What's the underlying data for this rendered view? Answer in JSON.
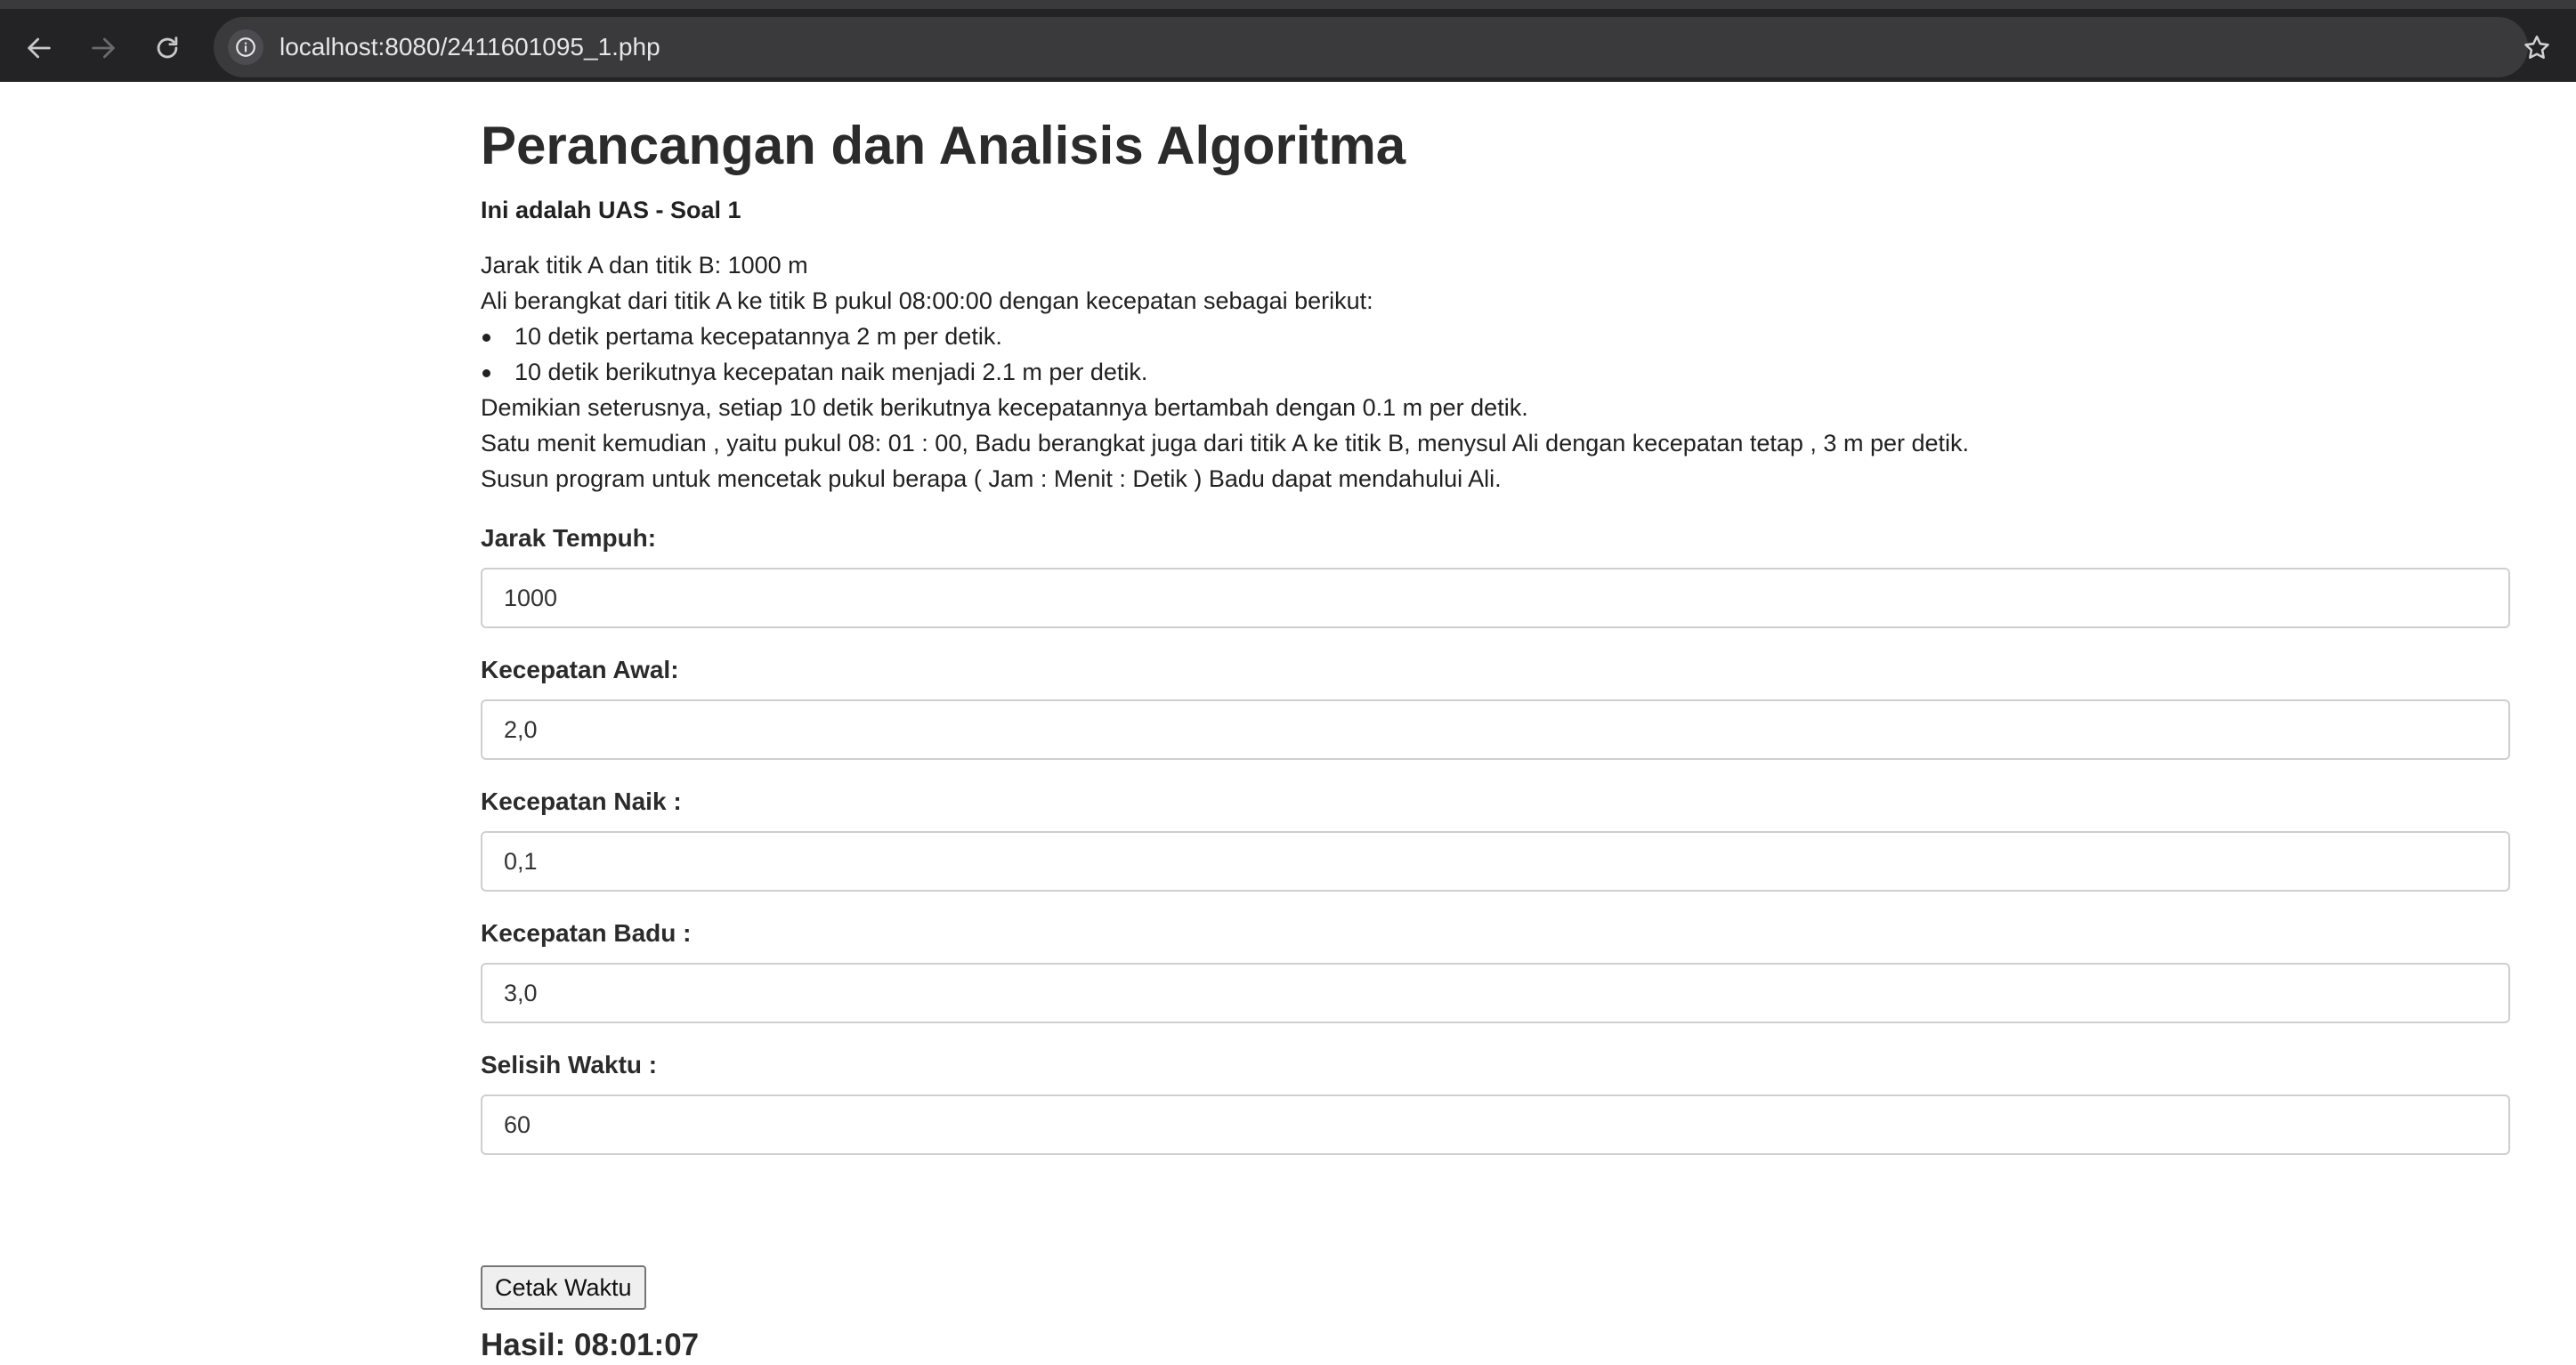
{
  "browser": {
    "url": "localhost:8080/2411601095_1.php",
    "icons": {
      "back": "arrow-left-icon",
      "forward": "arrow-right-icon",
      "reload": "reload-icon",
      "info": "info-icon",
      "bookmark": "star-icon"
    }
  },
  "page": {
    "title": "Perancangan dan Analisis Algoritma",
    "subtitle": "Ini adalah UAS - Soal 1",
    "description": {
      "line1": "Jarak titik A dan titik B: 1000 m",
      "line2": "Ali berangkat dari titik A ke titik B pukul 08:00:00 dengan kecepatan sebagai berikut:",
      "bullets": [
        "10 detik pertama kecepatannya 2 m per detik.",
        "10 detik berikutnya kecepatan naik menjadi 2.1 m per detik."
      ],
      "line3": "Demikian seterusnya, setiap 10 detik berikutnya kecepatannya bertambah dengan 0.1 m per detik.",
      "line4": "Satu menit kemudian , yaitu pukul 08: 01 : 00, Badu berangkat juga dari titik A ke titik B, menysul Ali dengan kecepatan tetap , 3 m per detik.",
      "line5": "Susun program untuk mencetak pukul berapa ( Jam : Menit : Detik ) Badu dapat mendahului Ali."
    },
    "form": {
      "fields": [
        {
          "label": "Jarak Tempuh:",
          "value": "1000"
        },
        {
          "label": "Kecepatan Awal:",
          "value": "2,0"
        },
        {
          "label": "Kecepatan Naik :",
          "value": "0,1"
        },
        {
          "label": "Kecepatan Badu :",
          "value": "3,0"
        },
        {
          "label": "Selisih Waktu :",
          "value": "60"
        }
      ],
      "submit_label": "Cetak Waktu"
    },
    "result": "Hasil: 08:01:07"
  }
}
